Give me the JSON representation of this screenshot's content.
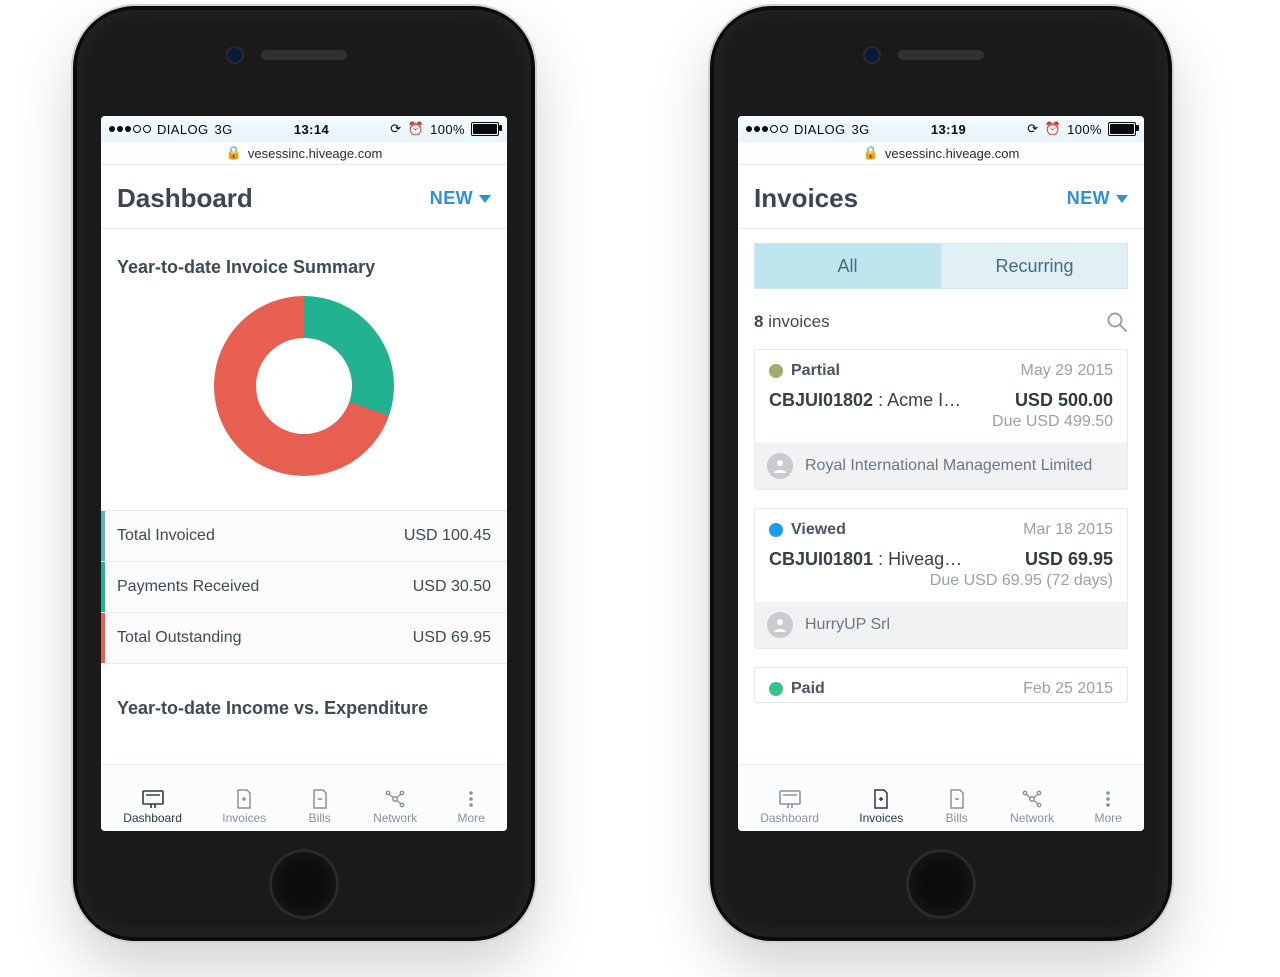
{
  "status": {
    "carrier": "DIALOG",
    "network": "3G",
    "battery": "100%",
    "left_time": "13:14",
    "right_time": "13:19"
  },
  "url": "vesessinc.hiveage.com",
  "common": {
    "new_label": "NEW",
    "tabs": [
      "Dashboard",
      "Invoices",
      "Bills",
      "Network",
      "More"
    ]
  },
  "dashboard": {
    "title": "Dashboard",
    "summary_title": "Year-to-date Invoice Summary",
    "rows": [
      {
        "label": "Total Invoiced",
        "value": "USD 100.45",
        "edge": "invoiced"
      },
      {
        "label": "Payments Received",
        "value": "USD 30.50",
        "edge": "received"
      },
      {
        "label": "Total Outstanding",
        "value": "USD 69.95",
        "edge": "outstanding"
      }
    ],
    "income_title": "Year-to-date Income vs. Expenditure"
  },
  "chart_data": {
    "type": "pie",
    "title": "Year-to-date Invoice Summary",
    "series": [
      {
        "name": "Payments Received",
        "value": 30.5,
        "color": "#22b28f"
      },
      {
        "name": "Total Outstanding",
        "value": 69.95,
        "color": "#e75f51"
      }
    ],
    "total_invoiced": 100.45,
    "currency": "USD",
    "donut_inner_ratio": 0.47
  },
  "invoices": {
    "title": "Invoices",
    "tabs": {
      "all": "All",
      "recurring": "Recurring"
    },
    "count_num": "8",
    "count_label": "invoices",
    "items": [
      {
        "status": "Partial",
        "dot": "olive",
        "date": "May 29 2015",
        "id": "CBJUI01802",
        "client": " : Acme I…",
        "amount": "USD 500.00",
        "due": "Due USD 499.50",
        "org": "Royal International Management Limited"
      },
      {
        "status": "Viewed",
        "dot": "blue",
        "date": "Mar 18 2015",
        "id": "CBJUI01801",
        "client": " : Hiveag…",
        "amount": "USD 69.95",
        "due": "Due USD 69.95 (72 days)",
        "org": "HurryUP Srl"
      },
      {
        "status": "Paid",
        "dot": "green",
        "date": "Feb 25 2015",
        "id": "",
        "client": "",
        "amount": "",
        "due": "",
        "org": ""
      }
    ]
  }
}
